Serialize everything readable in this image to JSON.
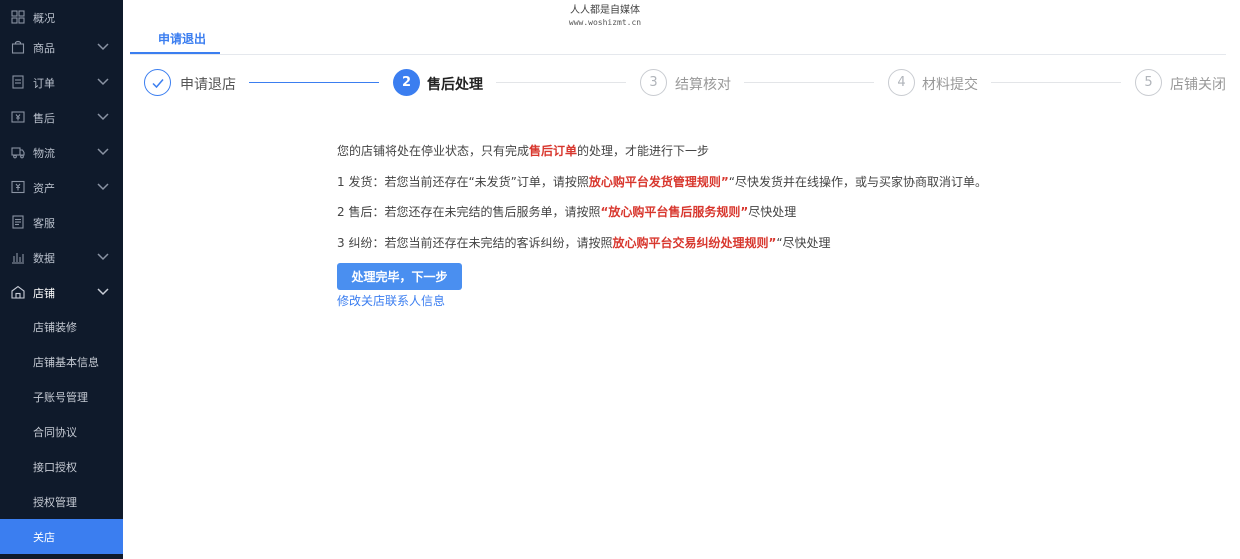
{
  "watermark": {
    "line1": "人人都是自媒体",
    "line2": "www.woshizmt.cn"
  },
  "sidebar": {
    "items": [
      {
        "label": "概况",
        "icon": "grid-icon",
        "has_chevron": false
      },
      {
        "label": "商品",
        "icon": "bag-icon",
        "has_chevron": true
      },
      {
        "label": "订单",
        "icon": "document-icon",
        "has_chevron": true
      },
      {
        "label": "售后",
        "icon": "yen-box-icon",
        "has_chevron": true
      },
      {
        "label": "物流",
        "icon": "truck-icon",
        "has_chevron": true
      },
      {
        "label": "资产",
        "icon": "yen-card-icon",
        "has_chevron": true
      },
      {
        "label": "客服",
        "icon": "chat-doc-icon",
        "has_chevron": false
      },
      {
        "label": "数据",
        "icon": "bar-chart-icon",
        "has_chevron": true
      },
      {
        "label": "店铺",
        "icon": "shop-icon",
        "has_chevron": true,
        "expanded": true
      }
    ],
    "sub_items": [
      {
        "label": "店铺装修"
      },
      {
        "label": "店铺基本信息"
      },
      {
        "label": "子账号管理"
      },
      {
        "label": "合同协议"
      },
      {
        "label": "接口授权"
      },
      {
        "label": "授权管理"
      },
      {
        "label": "关店",
        "active": true
      }
    ]
  },
  "tabs": {
    "active_label": "申请退出"
  },
  "steps": [
    {
      "index": "1",
      "label": "申请退店",
      "state": "done"
    },
    {
      "index": "2",
      "label": "售后处理",
      "state": "current"
    },
    {
      "index": "3",
      "label": "结算核对",
      "state": "todo"
    },
    {
      "index": "4",
      "label": "材料提交",
      "state": "todo"
    },
    {
      "index": "5",
      "label": "店铺关闭",
      "state": "todo"
    }
  ],
  "content": {
    "intro": {
      "before": "您的店铺将处在停业状态，只有完成",
      "highlight": "售后订单",
      "after": "的处理，才能进行下一步"
    },
    "item1": {
      "before": "1 发货：若您当前还存在“未发货”订单，请按照",
      "highlight": "放心购平台发货管理规则”",
      "after": "“尽快发货并在线操作，或与买家协商取消订单。"
    },
    "item2": {
      "before": "2 售后：若您还存在未完结的售后服务单，请按照",
      "highlight": "“放心购平台售后服务规则”",
      "after": "尽快处理"
    },
    "item3": {
      "before": "3 纠纷：若您当前还存在未完结的客诉纠纷，请按照",
      "highlight": "放心购平台交易纠纷处理规则”",
      "after": "“尽快处理"
    },
    "next_button": "处理完毕，下一步",
    "edit_link": "修改关店联系人信息"
  },
  "colors": {
    "accent": "#3b7ef0",
    "highlight_red": "#d8372e",
    "sidebar_bg": "#0f1a2b"
  }
}
